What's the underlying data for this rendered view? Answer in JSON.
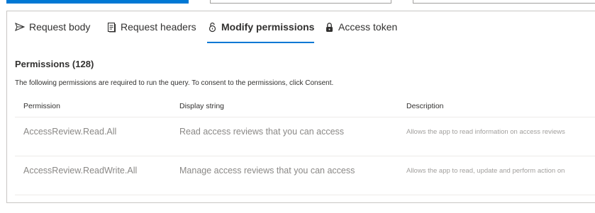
{
  "tabs": [
    {
      "label": "Request body",
      "icon": "send-icon"
    },
    {
      "label": "Request headers",
      "icon": "document-icon"
    },
    {
      "label": "Modify permissions",
      "icon": "unlock-icon"
    },
    {
      "label": "Access token",
      "icon": "lock-icon"
    }
  ],
  "active_tab": "Modify permissions",
  "permissions": {
    "title": "Permissions (128)",
    "description": "The following permissions are required to run the query. To consent to the permissions, click Consent.",
    "columns": [
      "Permission",
      "Display string",
      "Description"
    ],
    "rows": [
      {
        "permission": "AccessReview.Read.All",
        "display": "Read access reviews that you can access",
        "description": "Allows the app to read information on access reviews"
      },
      {
        "permission": "AccessReview.ReadWrite.All",
        "display": "Manage access reviews that you can access",
        "description": "Allows the app to read, update and perform action on"
      }
    ]
  },
  "colors": {
    "accent": "#0078d4",
    "border": "#c8c6c4",
    "muted_text": "#8a8886"
  }
}
